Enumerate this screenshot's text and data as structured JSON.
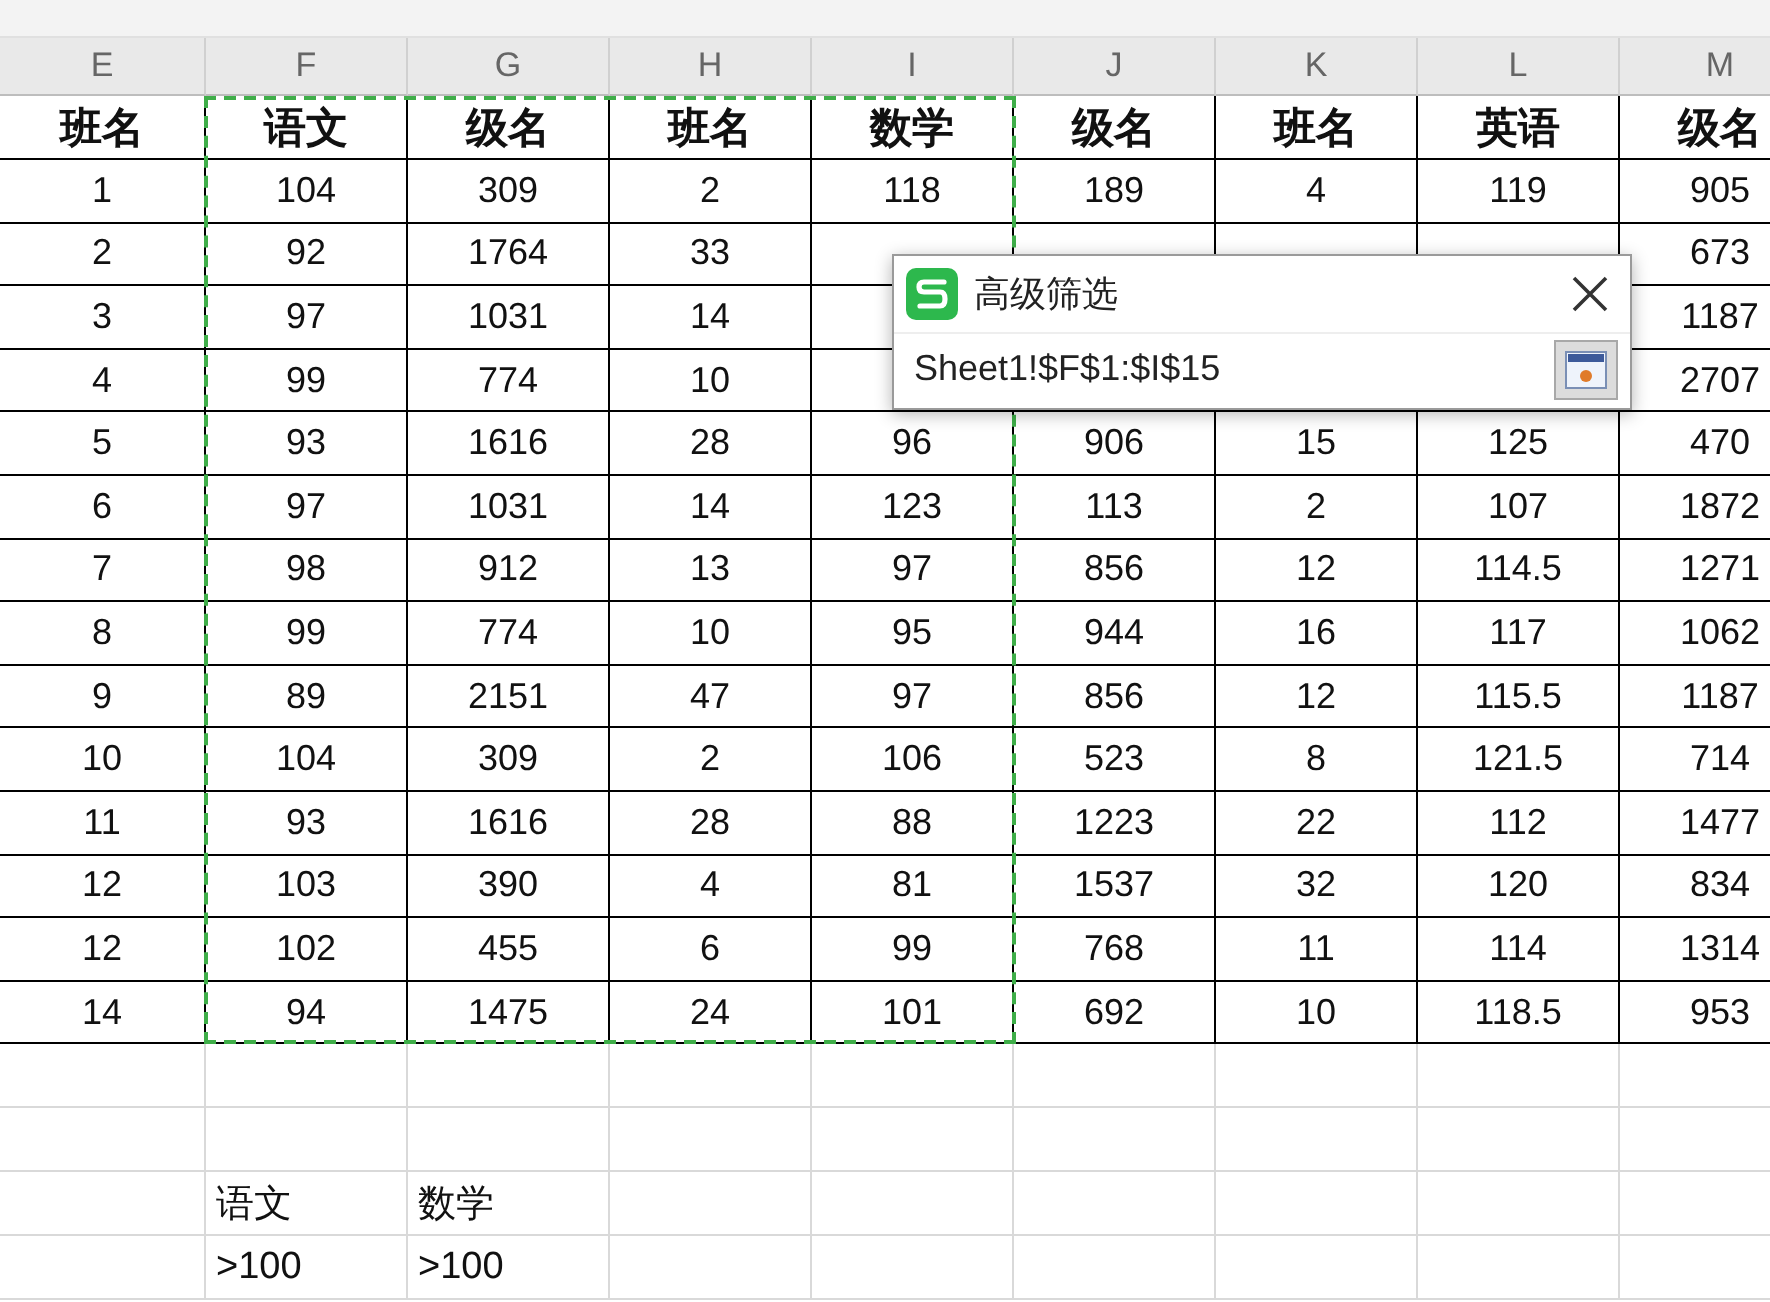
{
  "columns": [
    {
      "letter": "E",
      "marked": false
    },
    {
      "letter": "F",
      "marked": true
    },
    {
      "letter": "G",
      "marked": true
    },
    {
      "letter": "H",
      "marked": true
    },
    {
      "letter": "I",
      "marked": true
    },
    {
      "letter": "J",
      "marked": false
    },
    {
      "letter": "K",
      "marked": false
    },
    {
      "letter": "L",
      "marked": false
    },
    {
      "letter": "M",
      "marked": false
    }
  ],
  "rows": [
    {
      "kind": "header",
      "cells": [
        "班名",
        "语文",
        "级名",
        "班名",
        "数学",
        "级名",
        "班名",
        "英语",
        "级名"
      ]
    },
    {
      "kind": "data",
      "cells": [
        "1",
        "104",
        "309",
        "2",
        "118",
        "189",
        "4",
        "119",
        "905"
      ]
    },
    {
      "kind": "data",
      "cells": [
        "2",
        "92",
        "1764",
        "33",
        null,
        null,
        null,
        null,
        "673"
      ]
    },
    {
      "kind": "data",
      "cells": [
        "3",
        "97",
        "1031",
        "14",
        null,
        null,
        null,
        null,
        "1187"
      ]
    },
    {
      "kind": "data",
      "cells": [
        "4",
        "99",
        "774",
        "10",
        null,
        null,
        null,
        null,
        "2707"
      ]
    },
    {
      "kind": "data",
      "cells": [
        "5",
        "93",
        "1616",
        "28",
        "96",
        "906",
        "15",
        "125",
        "470"
      ]
    },
    {
      "kind": "data",
      "cells": [
        "6",
        "97",
        "1031",
        "14",
        "123",
        "113",
        "2",
        "107",
        "1872"
      ]
    },
    {
      "kind": "data",
      "cells": [
        "7",
        "98",
        "912",
        "13",
        "97",
        "856",
        "12",
        "114.5",
        "1271"
      ]
    },
    {
      "kind": "data",
      "cells": [
        "8",
        "99",
        "774",
        "10",
        "95",
        "944",
        "16",
        "117",
        "1062"
      ]
    },
    {
      "kind": "data",
      "cells": [
        "9",
        "89",
        "2151",
        "47",
        "97",
        "856",
        "12",
        "115.5",
        "1187"
      ]
    },
    {
      "kind": "data",
      "cells": [
        "10",
        "104",
        "309",
        "2",
        "106",
        "523",
        "8",
        "121.5",
        "714"
      ]
    },
    {
      "kind": "data",
      "cells": [
        "11",
        "93",
        "1616",
        "28",
        "88",
        "1223",
        "22",
        "112",
        "1477"
      ]
    },
    {
      "kind": "data",
      "cells": [
        "12",
        "103",
        "390",
        "4",
        "81",
        "1537",
        "32",
        "120",
        "834"
      ]
    },
    {
      "kind": "data",
      "cells": [
        "12",
        "102",
        "455",
        "6",
        "99",
        "768",
        "11",
        "114",
        "1314"
      ]
    },
    {
      "kind": "data",
      "cells": [
        "14",
        "94",
        "1475",
        "24",
        "101",
        "692",
        "10",
        "118.5",
        "953"
      ]
    },
    {
      "kind": "blank"
    },
    {
      "kind": "blank"
    },
    {
      "kind": "criteria",
      "cells": [
        null,
        "语文",
        "数学",
        null,
        null,
        null,
        null,
        null,
        null
      ]
    },
    {
      "kind": "criteria",
      "cells": [
        null,
        ">100",
        ">100",
        null,
        null,
        null,
        null,
        null,
        null
      ]
    }
  ],
  "dialog": {
    "title": "高级筛选",
    "range": "Sheet1!$F$1:$I$15"
  }
}
